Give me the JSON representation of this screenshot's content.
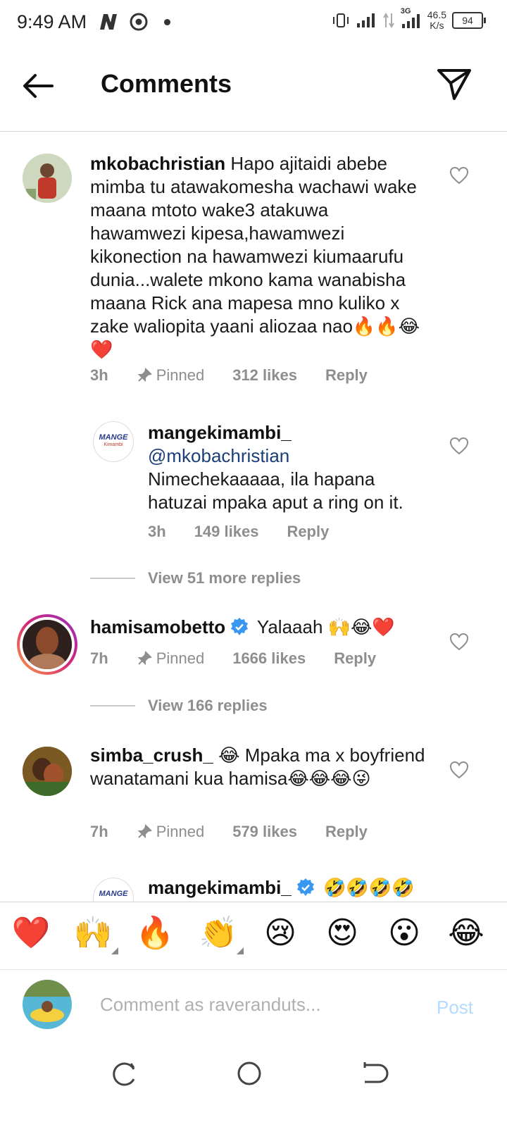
{
  "status_bar": {
    "time": "9:49 AM",
    "network": "3G",
    "speed_value": "46.5",
    "speed_unit": "K/s",
    "battery": "94"
  },
  "header": {
    "title": "Comments",
    "back_icon": "arrow-left-icon",
    "share_icon": "paper-plane-icon"
  },
  "comments": [
    {
      "username": "mkobachristian",
      "text": "Hapo ajitaidi abebe mimba tu atawakomesha wachawi wake maana mtoto wake3 atakuwa hawamwezi kipesa,hawamwezi kikonection na hawamwezi kiumaarufu dunia...walete mkono kama wanabisha maana Rick ana mapesa mno kuliko x zake waliopita yaani aliozaa nao🔥🔥😂❤️",
      "time": "3h",
      "pinned": "Pinned",
      "likes": "312 likes",
      "reply": "Reply"
    },
    {
      "username": "mangekimambi_",
      "mention": "@mkobachristian",
      "text": "Nimechekaaaaa, ila hapana hatuzai mpaka aput a ring on it.",
      "time": "3h",
      "likes": "149 likes",
      "reply": "Reply",
      "avatar_text": "MANGE",
      "avatar_subtext": "Kimambi"
    },
    {
      "username": "hamisamobetto",
      "text": "Yalaaah 🙌😂❤️",
      "time": "7h",
      "pinned": "Pinned",
      "likes": "1666 likes",
      "reply": "Reply"
    },
    {
      "username": "simba_crush_",
      "text": "😂 Mpaka ma x boyfriend wanatamani kua hamisa😂😂😂😜",
      "time": "7h",
      "pinned": "Pinned",
      "likes": "579 likes",
      "reply": "Reply"
    },
    {
      "username": "mangekimambi_",
      "text": "🤣🤣🤣🤣",
      "avatar_text": "MANGE"
    }
  ],
  "view_replies": [
    "View 51 more replies",
    "View 166 replies"
  ],
  "emoji_bar": [
    "❤️",
    "🙌",
    "🔥",
    "👏",
    "😢",
    "😍",
    "😮",
    "😂"
  ],
  "composer": {
    "placeholder": "Comment as raveranduts...",
    "post_label": "Post"
  },
  "nav": {
    "recents_icon": "recents-icon",
    "home_icon": "home-circle-icon",
    "back_icon": "nav-back-icon"
  },
  "colors": {
    "mention": "#1c3f7a",
    "post_disabled": "#b3dbff",
    "verified": "#3897f0",
    "muted": "#8e8e8e"
  }
}
